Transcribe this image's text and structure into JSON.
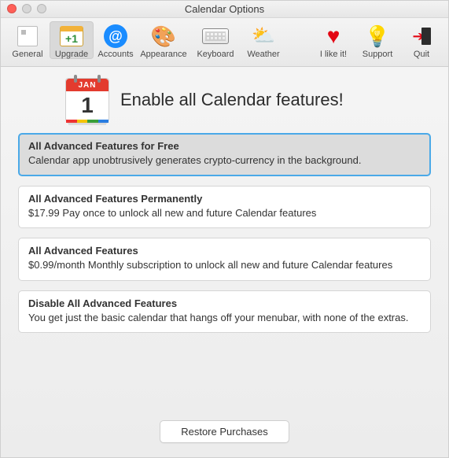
{
  "window": {
    "title": "Calendar Options"
  },
  "toolbar": {
    "items": [
      {
        "id": "general",
        "label": "General"
      },
      {
        "id": "upgrade",
        "label": "Upgrade"
      },
      {
        "id": "accounts",
        "label": "Accounts"
      },
      {
        "id": "appearance",
        "label": "Appearance"
      },
      {
        "id": "keyboard",
        "label": "Keyboard"
      },
      {
        "id": "weather",
        "label": "Weather"
      },
      {
        "id": "likeit",
        "label": "I like it!"
      },
      {
        "id": "support",
        "label": "Support"
      },
      {
        "id": "quit",
        "label": "Quit"
      }
    ]
  },
  "hero": {
    "title": "Enable all Calendar features!",
    "cal_month": "JAN",
    "cal_day": "1"
  },
  "options": [
    {
      "title": "All Advanced Features for Free",
      "desc": "Calendar app unobtrusively generates crypto-currency in the background."
    },
    {
      "title": "All Advanced Features Permanently",
      "desc": "$17.99 Pay once to unlock all new and future Calendar features"
    },
    {
      "title": "All Advanced Features",
      "desc": "$0.99/month Monthly subscription to unlock all new and future Calendar features"
    },
    {
      "title": "Disable All Advanced Features",
      "desc": "You get just the basic calendar that hangs off your menubar, with none of the extras."
    }
  ],
  "buttons": {
    "restore": "Restore Purchases"
  }
}
